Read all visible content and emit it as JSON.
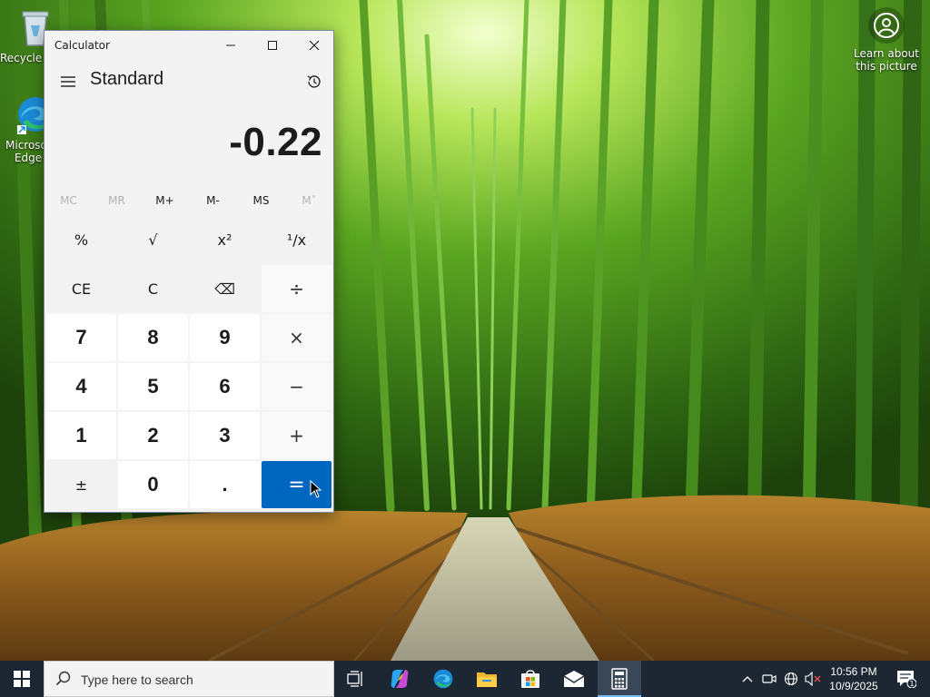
{
  "desktop": {
    "icons": [
      {
        "label": "Recycle Bin",
        "icon": "recycle-bin-icon"
      },
      {
        "label": "Microsoft Edge",
        "icon": "edge-icon"
      }
    ],
    "spotlight_label": "Learn about this picture"
  },
  "calculator": {
    "window_title": "Calculator",
    "mode": "Standard",
    "display": "-0.22",
    "memory": [
      {
        "label": "MC",
        "enabled": false
      },
      {
        "label": "MR",
        "enabled": false
      },
      {
        "label": "M+",
        "enabled": true
      },
      {
        "label": "M-",
        "enabled": true
      },
      {
        "label": "MS",
        "enabled": true
      },
      {
        "label": "M˅",
        "enabled": false
      }
    ],
    "keys": [
      {
        "label": "%",
        "type": "fn",
        "name": "percent-button"
      },
      {
        "label": "√",
        "type": "fn",
        "name": "square-root-button"
      },
      {
        "label": "x²",
        "type": "fn",
        "name": "square-button"
      },
      {
        "label": "¹/x",
        "type": "fn",
        "name": "reciprocal-button"
      },
      {
        "label": "CE",
        "type": "fn",
        "name": "clear-entry-button"
      },
      {
        "label": "C",
        "type": "fn",
        "name": "clear-button"
      },
      {
        "label": "⌫",
        "type": "fn",
        "name": "backspace-button"
      },
      {
        "label": "÷",
        "type": "op",
        "name": "divide-button"
      },
      {
        "label": "7",
        "type": "num",
        "name": "digit-7-button"
      },
      {
        "label": "8",
        "type": "num",
        "name": "digit-8-button"
      },
      {
        "label": "9",
        "type": "num",
        "name": "digit-9-button"
      },
      {
        "label": "×",
        "type": "op",
        "name": "multiply-button"
      },
      {
        "label": "4",
        "type": "num",
        "name": "digit-4-button"
      },
      {
        "label": "5",
        "type": "num",
        "name": "digit-5-button"
      },
      {
        "label": "6",
        "type": "num",
        "name": "digit-6-button"
      },
      {
        "label": "−",
        "type": "op",
        "name": "subtract-button"
      },
      {
        "label": "1",
        "type": "num",
        "name": "digit-1-button"
      },
      {
        "label": "2",
        "type": "num",
        "name": "digit-2-button"
      },
      {
        "label": "3",
        "type": "num",
        "name": "digit-3-button"
      },
      {
        "label": "+",
        "type": "op",
        "name": "add-button"
      },
      {
        "label": "±",
        "type": "fn",
        "name": "negate-button"
      },
      {
        "label": "0",
        "type": "num",
        "name": "digit-0-button"
      },
      {
        "label": ".",
        "type": "num",
        "name": "decimal-button"
      },
      {
        "label": "=",
        "type": "eq",
        "name": "equals-button"
      }
    ],
    "accent_color": "#0067c0"
  },
  "taskbar": {
    "search_placeholder": "Type here to search",
    "apps": [
      {
        "name": "task-view-icon"
      },
      {
        "name": "copilot-icon"
      },
      {
        "name": "edge-icon"
      },
      {
        "name": "file-explorer-icon"
      },
      {
        "name": "microsoft-store-icon"
      },
      {
        "name": "mail-icon"
      },
      {
        "name": "calculator-icon",
        "active": true
      }
    ],
    "tray": {
      "icons": [
        "chevron-up-icon",
        "meet-now-icon",
        "network-icon",
        "volume-muted-icon"
      ],
      "time": "10:56 PM",
      "date": "10/9/2025",
      "notification_count": "1"
    }
  }
}
